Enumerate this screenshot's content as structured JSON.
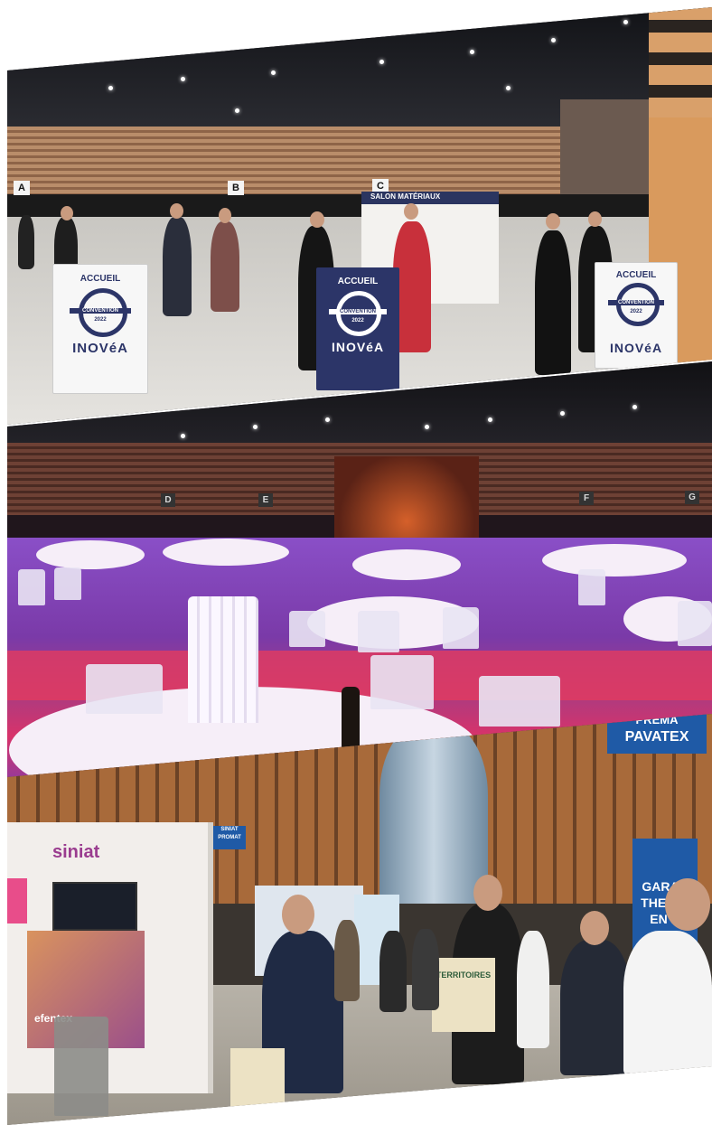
{
  "photo1": {
    "zone_letters": [
      "A",
      "B",
      "C"
    ],
    "podium_heading": "ACCUEIL",
    "badge_text": "CONVENTION",
    "badge_year": "2022",
    "brand": "INOVéA",
    "board_title": "SALON MATÉRIAUX"
  },
  "photo2": {
    "zone_letters": [
      "D",
      "E",
      "F",
      "G"
    ]
  },
  "photo3": {
    "siniat_logo": "siniat",
    "stand_product": "efentex",
    "top_sign": "PAVATEX",
    "top_sign_partial": "PREMA",
    "right_banner_lines": [
      "GARAN",
      "THERMI",
      "EN R"
    ],
    "tote_bag": "TERRITOIRES",
    "small_sign": "SINIAT PROMAT"
  },
  "colors": {
    "inovea_navy": "#2c3568",
    "stage_magenta": "#c02a7a",
    "floor_purple": "#7a3aa8",
    "banner_blue": "#1f5aa6"
  }
}
